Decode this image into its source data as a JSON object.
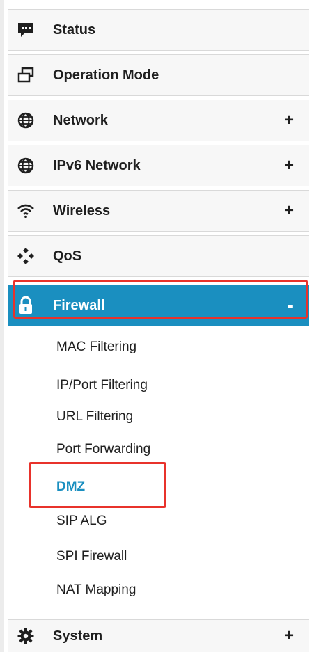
{
  "menu": {
    "items": [
      {
        "label": "Status",
        "icon": "chat-bubble-icon",
        "expander": ""
      },
      {
        "label": "Operation Mode",
        "icon": "windows-icon",
        "expander": ""
      },
      {
        "label": "Network",
        "icon": "globe-icon",
        "expander": "+"
      },
      {
        "label": "IPv6 Network",
        "icon": "globe-icon",
        "expander": "+"
      },
      {
        "label": "Wireless",
        "icon": "wifi-icon",
        "expander": "+"
      },
      {
        "label": "QoS",
        "icon": "diamonds-icon",
        "expander": ""
      },
      {
        "label": "Firewall",
        "icon": "lock-icon",
        "expander": "-"
      },
      {
        "label": "System",
        "icon": "gear-icon",
        "expander": "+"
      }
    ],
    "firewall_sub": [
      {
        "label": "MAC Filtering"
      },
      {
        "label": "IP/Port Filtering"
      },
      {
        "label": "URL Filtering"
      },
      {
        "label": "Port Forwarding"
      },
      {
        "label": "DMZ"
      },
      {
        "label": "SIP ALG"
      },
      {
        "label": "SPI Firewall"
      },
      {
        "label": "NAT Mapping"
      }
    ]
  },
  "colors": {
    "active_bg": "#1a8fc0",
    "selected_text": "#1a8fc0",
    "highlight_border": "#e8322b"
  }
}
